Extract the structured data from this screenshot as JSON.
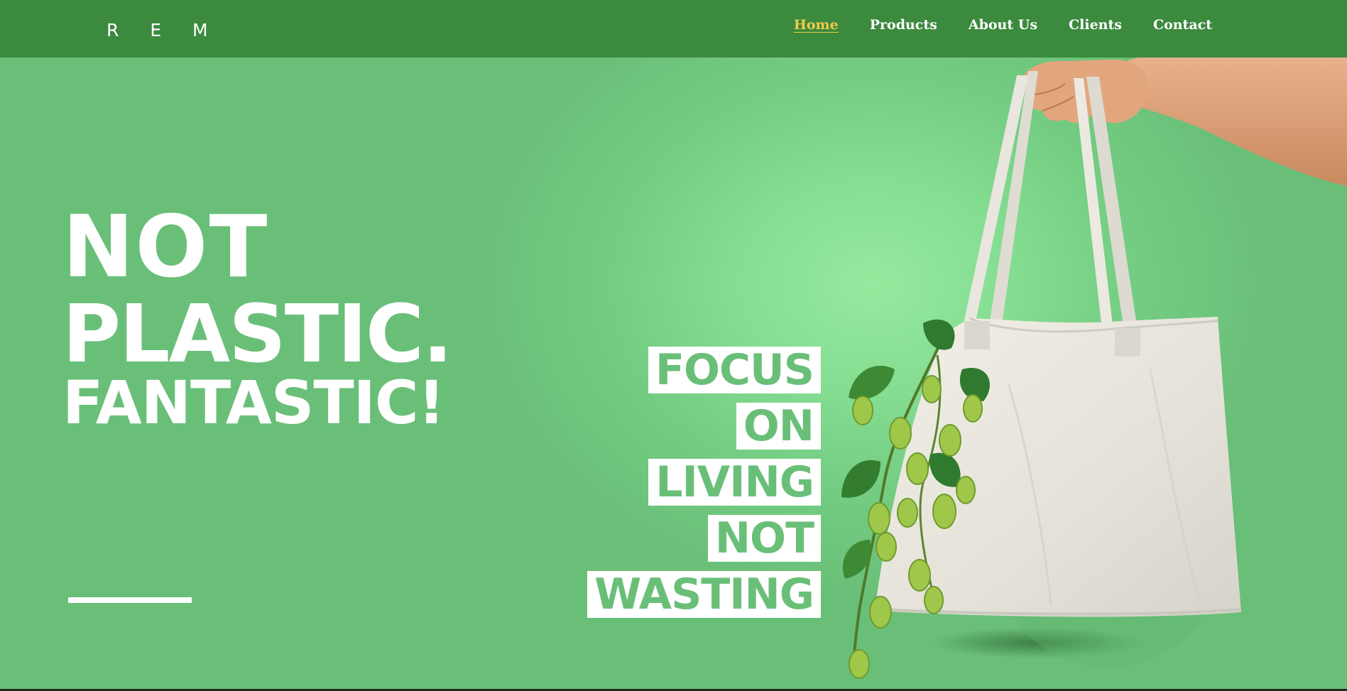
{
  "header": {
    "logo": "R E M",
    "nav": [
      {
        "label": "Home",
        "active": true
      },
      {
        "label": "Products",
        "active": false
      },
      {
        "label": "About Us",
        "active": false
      },
      {
        "label": "Clients",
        "active": false
      },
      {
        "label": "Contact",
        "active": false
      }
    ]
  },
  "hero": {
    "headline": [
      "NOT",
      "PLASTIC.",
      "FANTASTIC!"
    ],
    "slogan": [
      "FOCUS",
      "ON",
      "LIVING",
      "NOT",
      "WASTING"
    ]
  },
  "colors": {
    "header_bg": "#3b8a3e",
    "background": "#6abf78",
    "highlight": "#95ea9e",
    "active_nav": "#f2c94c",
    "text": "#ffffff"
  },
  "images": {
    "bag": "tote-bag-icon",
    "hand": "hand-icon",
    "hops": "hops-plant-icon"
  }
}
